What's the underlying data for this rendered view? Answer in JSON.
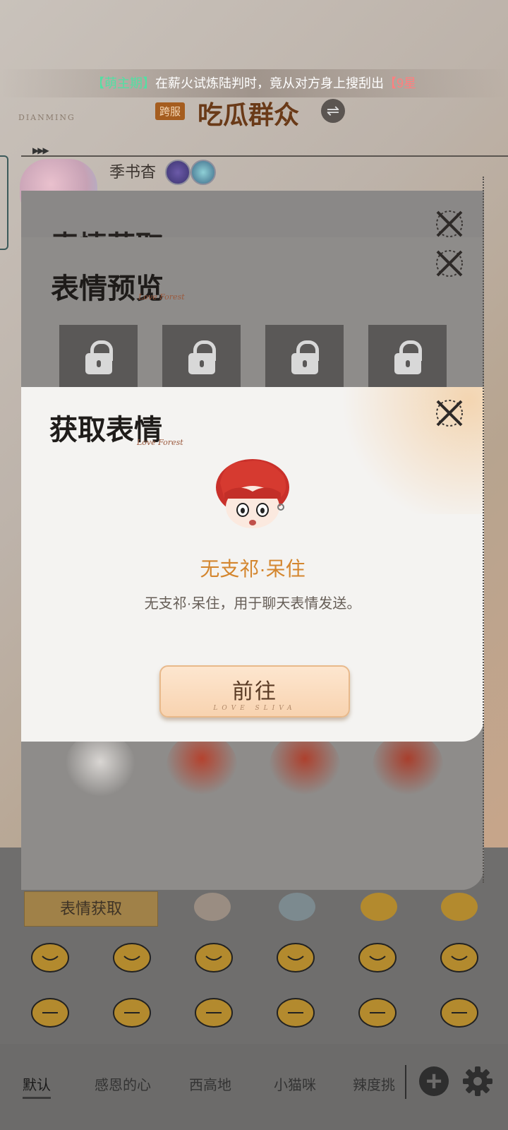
{
  "marquee": {
    "tag": "【萌主期】",
    "text": "在薪火试炼陆判时，竟从对方身上搜刮出",
    "tail": "【9星"
  },
  "server": {
    "badge": "跨服",
    "name": "吃瓜群众"
  },
  "brand_text": "DIANMING",
  "user": {
    "name": "季书杳"
  },
  "panels": {
    "back_title": "表情获取",
    "preview_title": "表情预览",
    "signature": "Love Forest"
  },
  "dialog": {
    "title": "获取表情",
    "signature": "Love Forest",
    "item_name": "无支祁·呆住",
    "item_desc": "无支祁·呆住，用于聊天表情发送。",
    "button_label": "前往",
    "button_sub": "LOVE SLIVA"
  },
  "category_button": "表情获取",
  "tabs": [
    "默认",
    "感恩的心",
    "西高地",
    "小猫咪",
    "辣度挑"
  ],
  "active_tab_index": 0,
  "colors": {
    "accent_orange": "#d4862e",
    "marquee_tag": "#52e0a3",
    "marquee_tail": "#ff7f7f"
  }
}
